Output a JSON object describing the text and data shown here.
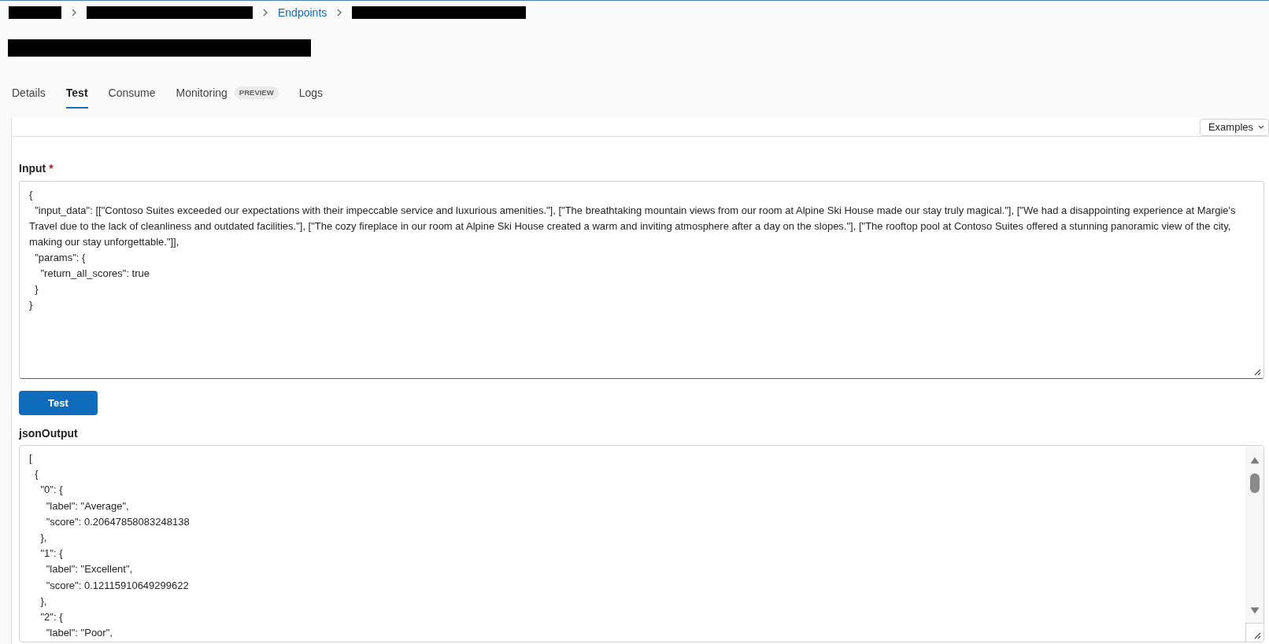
{
  "breadcrumb": [
    {
      "kind": "redacted"
    },
    {
      "kind": "redacted"
    },
    {
      "kind": "link",
      "text": "Endpoints"
    },
    {
      "kind": "redacted"
    }
  ],
  "title": {
    "kind": "redacted"
  },
  "tabs": [
    {
      "label": "Details",
      "selected": false
    },
    {
      "label": "Test",
      "selected": true
    },
    {
      "label": "Consume",
      "selected": false
    },
    {
      "label": "Monitoring",
      "selected": false,
      "badge": "PREVIEW"
    },
    {
      "label": "Logs",
      "selected": false
    }
  ],
  "test_panel": {
    "examples_button": {
      "label": "Examples"
    },
    "input": {
      "label": "Input",
      "required_mark": "*",
      "value": "{\n  \"input_data\": [[\"Contoso Suites exceeded our expectations with their impeccable service and luxurious amenities.\"], [\"The breathtaking mountain views from our room at Alpine Ski House made our stay truly magical.\"], [\"We had a disappointing experience at Margie's Travel due to the lack of cleanliness and outdated facilities.\"], [\"The cozy fireplace in our room at Alpine Ski House created a warm and inviting atmosphere after a day on the slopes.\"], [\"The rooftop pool at Contoso Suites offered a stunning panoramic view of the city, making our stay unforgettable.\"]],\n  \"params\": {\n    \"return_all_scores\": true\n  }\n}"
    },
    "test_button": {
      "label": "Test"
    },
    "output": {
      "label": "jsonOutput",
      "value": "[\n  {\n    \"0\": {\n      \"label\": \"Average\",\n      \"score\": 0.20647858083248138\n    },\n    \"1\": {\n      \"label\": \"Excellent\",\n      \"score\": 0.12115910649299622\n    },\n    \"2\": {\n      \"label\": \"Poor\","
    }
  }
}
